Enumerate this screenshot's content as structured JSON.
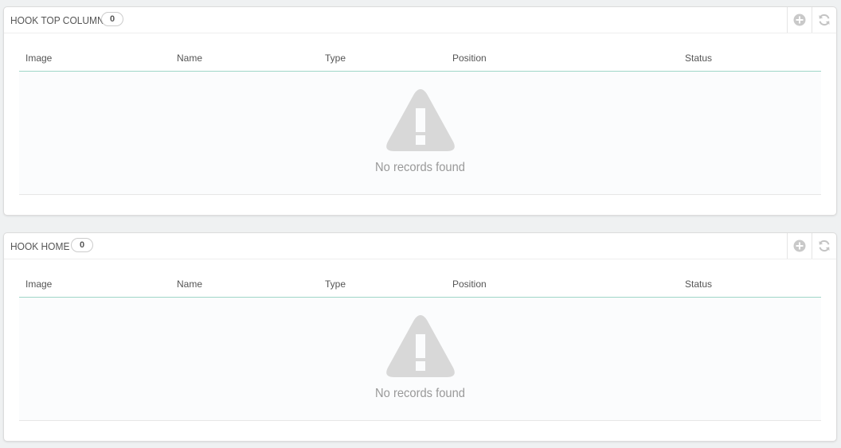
{
  "panels": [
    {
      "title": "HOOK TOP COLUMN",
      "count": "0",
      "columns": [
        "Image",
        "Name",
        "Type",
        "Position",
        "Status"
      ],
      "empty_text": "No records found"
    },
    {
      "title": "HOOK HOME",
      "count": "0",
      "columns": [
        "Image",
        "Name",
        "Type",
        "Position",
        "Status"
      ],
      "empty_text": "No records found"
    }
  ],
  "icons": {
    "add": "plus-circle-icon",
    "refresh": "refresh-icon",
    "empty": "warning-icon"
  },
  "colors": {
    "header_border": "#9fd6c8",
    "icon_gray": "#d8d8d8"
  }
}
